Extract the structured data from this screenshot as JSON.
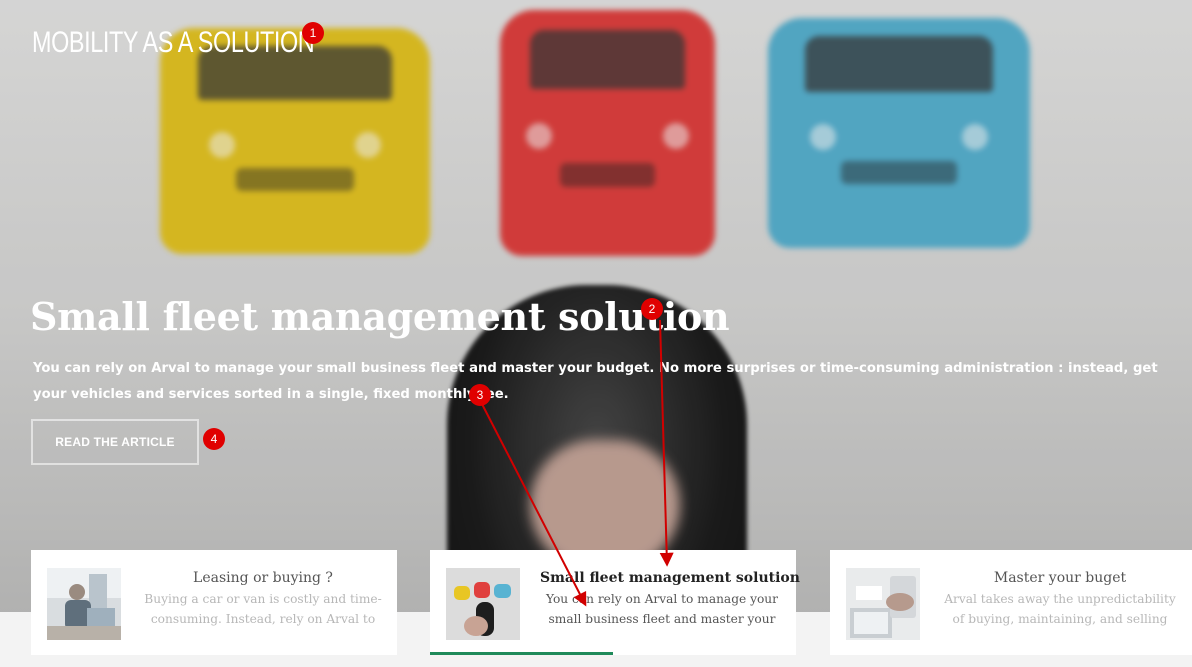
{
  "hero": {
    "kicker": "MOBILITY AS A SOLUTION",
    "title": "Small fleet management solution",
    "description": "You can rely on Arval to manage your small business fleet and master your budget. No more surprises or time-consuming administration : instead, get your vehicles and services sorted in a single, fixed monthly fee.",
    "cta_label": "READ THE ARTICLE"
  },
  "cards": [
    {
      "title": "Leasing or buying ?",
      "description": "Buying a car or van is costly and time-consuming. Instead, rely on Arval to",
      "icon": "office-photo"
    },
    {
      "title": "Small fleet management solution",
      "description": "You can rely on Arval to manage your small business fleet and master your",
      "icon": "cars-and-key-photo",
      "active": true
    },
    {
      "title": "Master your buget",
      "description": "Arval takes away the unpredictability of buying, maintaining, and selling",
      "icon": "calculator-photo"
    }
  ],
  "annotations": {
    "badge1": "1",
    "badge2": "2",
    "badge3": "3",
    "badge4": "4"
  },
  "colors": {
    "active_underline": "#1f8a5a",
    "badge": "#e00000",
    "arrow": "#d10000"
  }
}
